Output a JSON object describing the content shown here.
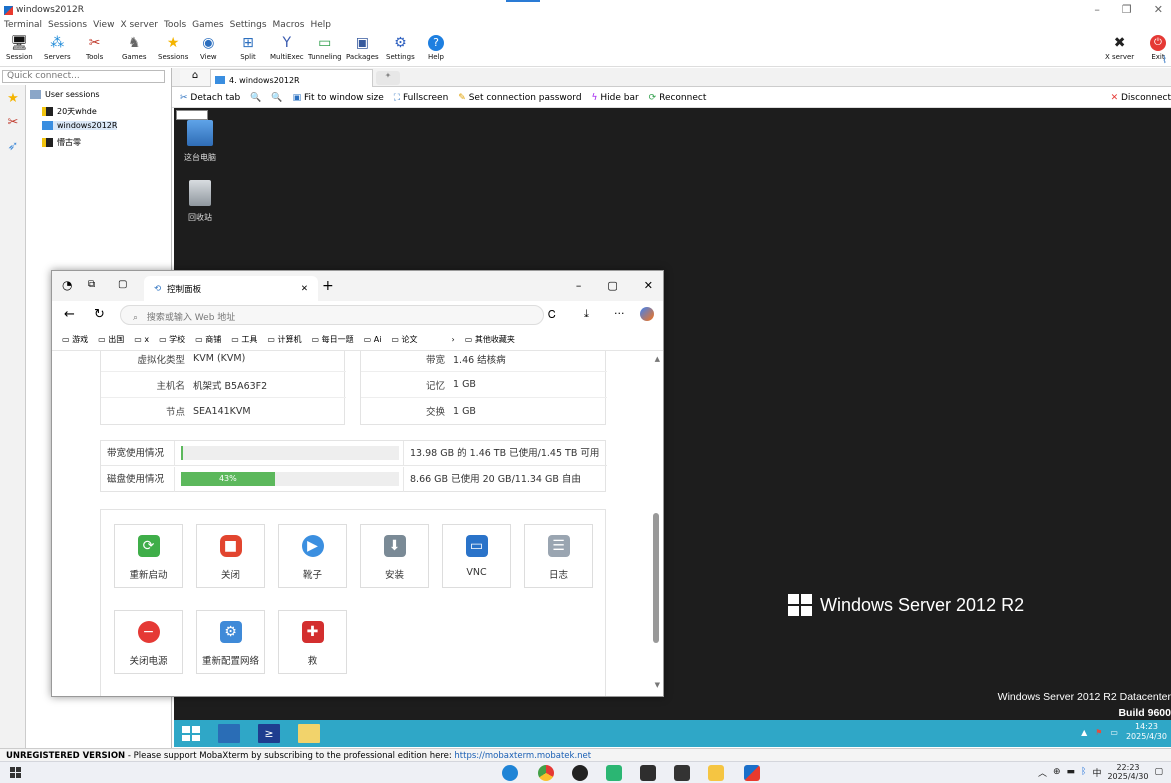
{
  "window": {
    "title": "windows2012R"
  },
  "menu": [
    "Terminal",
    "Sessions",
    "View",
    "X server",
    "Tools",
    "Games",
    "Settings",
    "Macros",
    "Help"
  ],
  "toolbar": {
    "items": [
      {
        "label": "Session",
        "icon": "session-icon"
      },
      {
        "label": "Servers",
        "icon": "servers-icon"
      },
      {
        "label": "Tools",
        "icon": "tools-icon"
      },
      {
        "label": "Games",
        "icon": "games-icon"
      },
      {
        "label": "Sessions",
        "icon": "star-icon"
      },
      {
        "label": "View",
        "icon": "view-icon"
      },
      {
        "label": "Split",
        "icon": "split-icon"
      },
      {
        "label": "MultiExec",
        "icon": "multiexec-icon"
      },
      {
        "label": "Tunneling",
        "icon": "tunneling-icon"
      },
      {
        "label": "Packages",
        "icon": "packages-icon"
      },
      {
        "label": "Settings",
        "icon": "settings-icon"
      },
      {
        "label": "Help",
        "icon": "help-icon"
      }
    ],
    "xserver_label": "X server",
    "exit_label": "Exit"
  },
  "left": {
    "quick_connect_placeholder": "Quick connect...",
    "tree": {
      "root": "User sessions",
      "items": [
        "20天whde",
        "windows2012R",
        "懵古零"
      ]
    }
  },
  "tabs": {
    "session_tab": "4. windows2012R"
  },
  "session_toolbar": {
    "detach": "Detach tab",
    "fit": "Fit to window size",
    "fullscreen": "Fullscreen",
    "password": "Set connection password",
    "hidebar": "Hide bar",
    "reconnect": "Reconnect",
    "disconnect": "Disconnect"
  },
  "remote": {
    "desktop_icons": [
      "这台电脑",
      "回收站"
    ],
    "logo_text": "Windows Server 2012 R2",
    "info_line1": "Windows Server 2012 R2 Datacenter",
    "info_line2": "Build 9600",
    "clock_time": "14:23",
    "clock_date": "2025/4/30"
  },
  "browser": {
    "tab_title": "控制面板",
    "address_placeholder": "搜索或输入 Web 地址",
    "favorites": [
      "游戏",
      "出国",
      "x",
      "学校",
      "商铺",
      "工具",
      "计算机",
      "每日一题",
      "Ai",
      "论文"
    ],
    "favorites_other": "其他收藏夹",
    "info_left": [
      {
        "k": "虚拟化类型",
        "v": "KVM (KVM)"
      },
      {
        "k": "主机名",
        "v": "机架式 B5A63F2"
      },
      {
        "k": "节点",
        "v": "SEA141KVM"
      }
    ],
    "info_right": [
      {
        "k": "带宽",
        "v": "1.46 结核病"
      },
      {
        "k": "记忆",
        "v": "1 GB"
      },
      {
        "k": "交换",
        "v": "1 GB"
      }
    ],
    "usage": [
      {
        "label": "带宽使用情况",
        "percent": 1,
        "bar_text": "",
        "detail": "13.98 GB 的 1.46 TB 已使用/1.45 TB 可用"
      },
      {
        "label": "磁盘使用情况",
        "percent": 43,
        "bar_text": "43%",
        "detail": "8.66 GB 已使用 20 GB/11.34 GB 自由"
      }
    ],
    "actions": [
      {
        "label": "重新启动",
        "icon": "restart-icon",
        "color": "#3fae49"
      },
      {
        "label": "关闭",
        "icon": "stop-icon",
        "color": "#e2452f"
      },
      {
        "label": "靴子",
        "icon": "boot-icon",
        "color": "#3b8fe0"
      },
      {
        "label": "安装",
        "icon": "install-icon",
        "color": "#7a8a96"
      },
      {
        "label": "VNC",
        "icon": "vnc-icon",
        "color": "#2a73c9"
      },
      {
        "label": "日志",
        "icon": "log-icon",
        "color": "#9aa5b1"
      },
      {
        "label": "关闭电源",
        "icon": "power-off-icon",
        "color": "#e53935"
      },
      {
        "label": "重新配置网络",
        "icon": "network-icon",
        "color": "#3f8ad8"
      },
      {
        "label": "救",
        "icon": "rescue-icon",
        "color": "#d32f2f"
      }
    ]
  },
  "status": {
    "unregistered": "UNREGISTERED VERSION",
    "message": " -  Please support MobaXterm by subscribing to the professional edition here: ",
    "link": "https://mobaxterm.mobatek.net"
  },
  "host_taskbar": {
    "ime": "中",
    "time": "22:23",
    "date": "2025/4/30"
  }
}
